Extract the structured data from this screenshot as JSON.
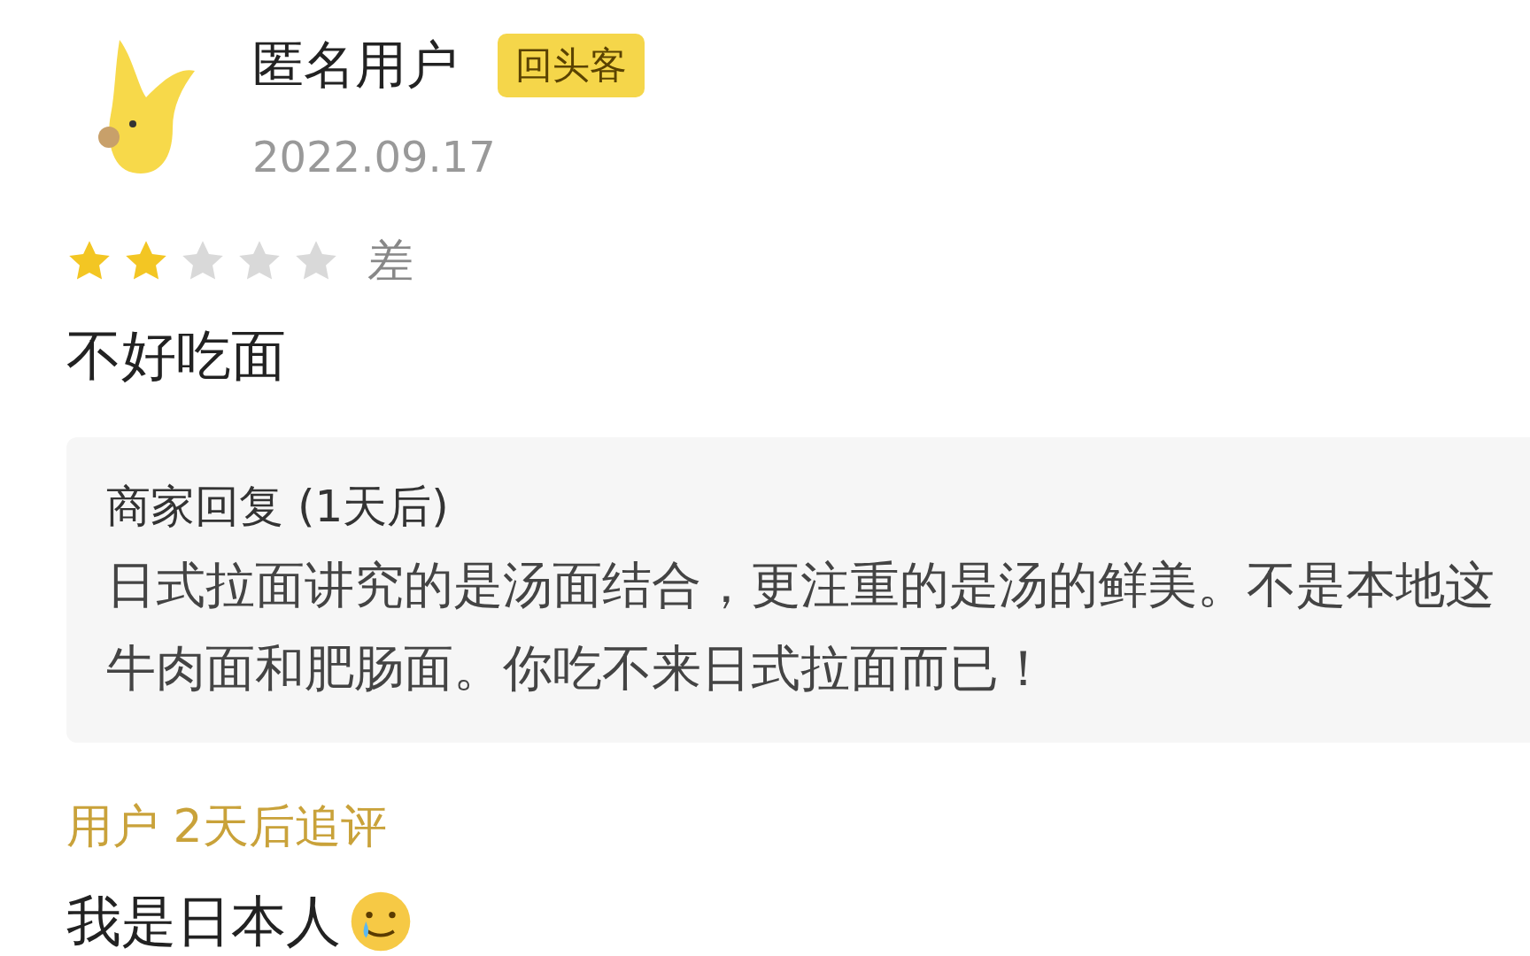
{
  "review": {
    "user_name": "匿名用户",
    "badge": "回头客",
    "date": "2022.09.17",
    "stars": 2,
    "rating_label": "差",
    "text": "不好吃面"
  },
  "merchant_reply": {
    "title": "商家回复 (1天后)",
    "lines": [
      "日式拉面讲究的是汤面结合，更注重的是汤的鲜美。不是本地这",
      "牛肉面和肥肠面。你吃不来日式拉面而已！"
    ]
  },
  "follow_up": {
    "title": "用户 2天后追评",
    "text": "我是日本人"
  }
}
